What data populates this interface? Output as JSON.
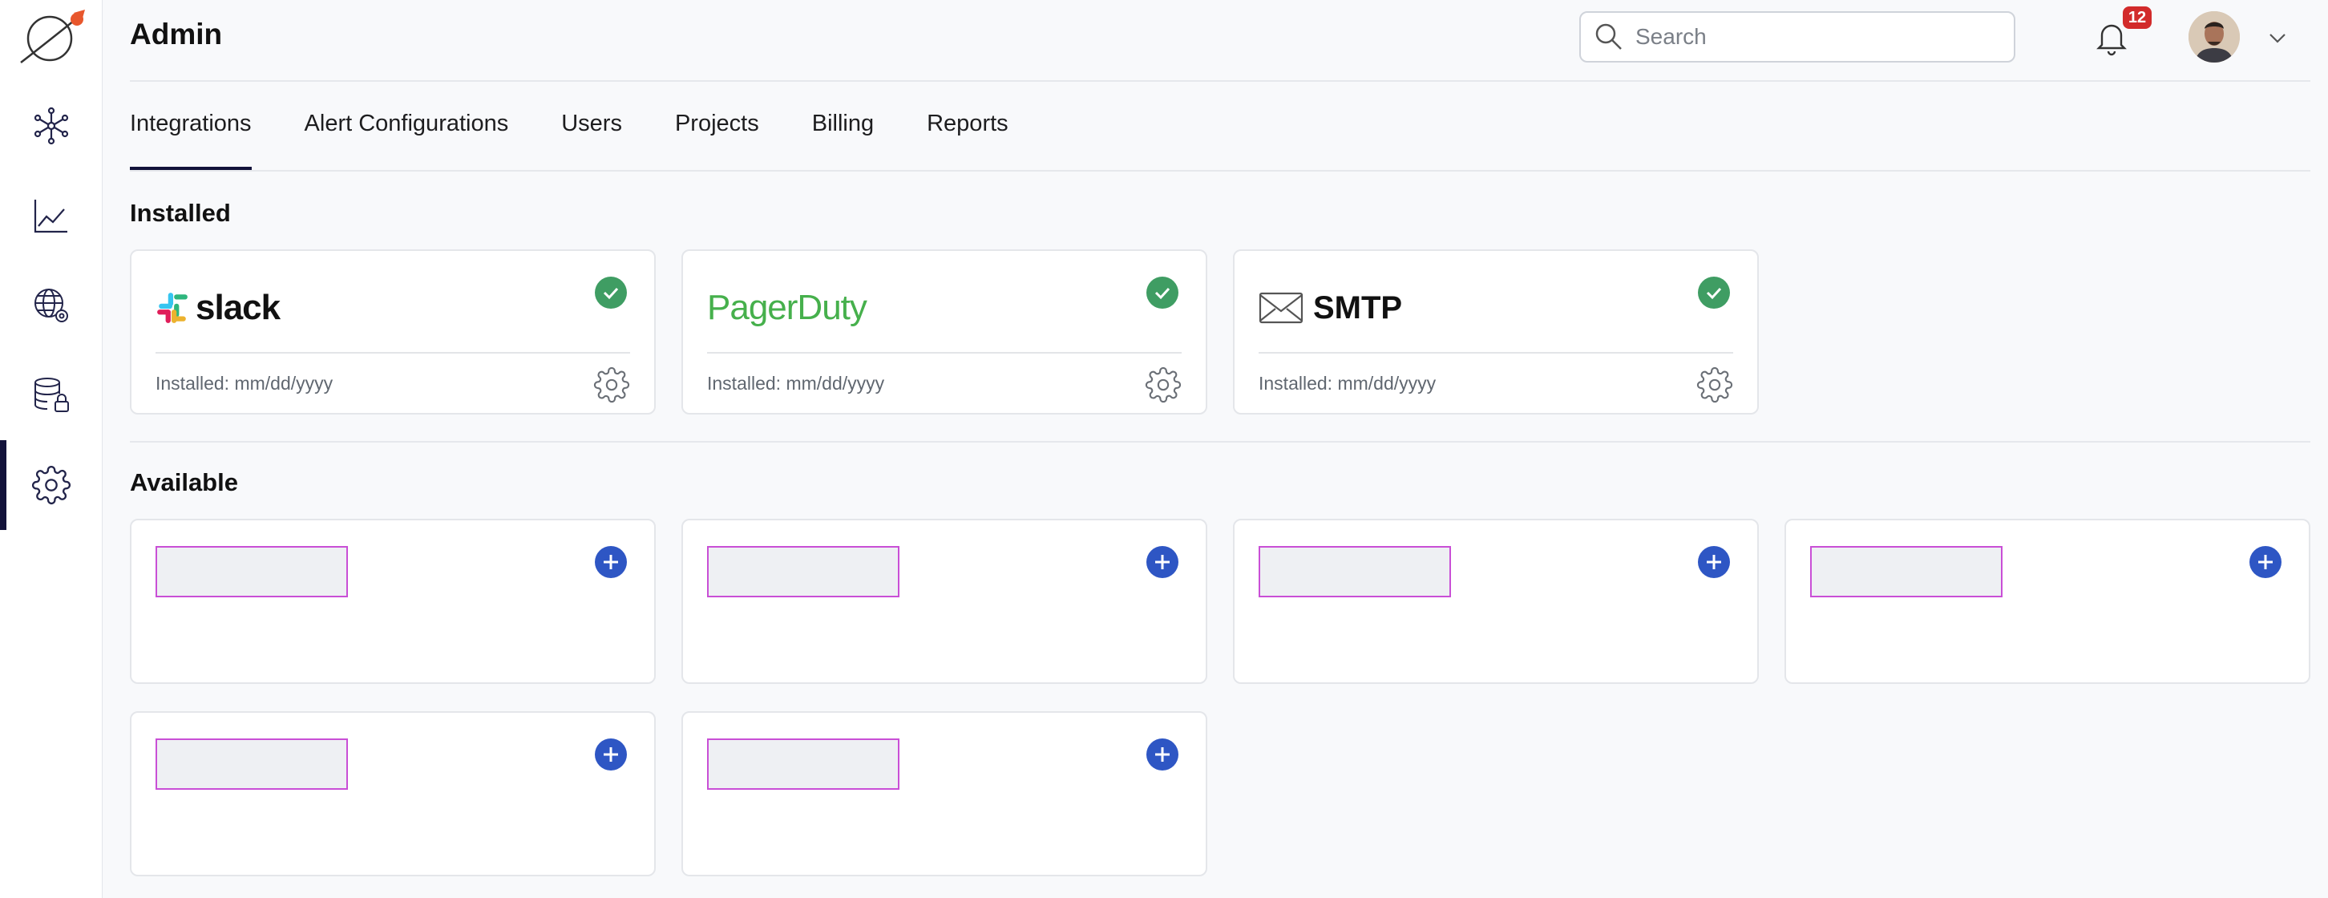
{
  "header": {
    "title": "Admin",
    "search_placeholder": "Search",
    "notification_count": "12"
  },
  "sidebar": {
    "items": [
      {
        "icon": "network-icon"
      },
      {
        "icon": "chart-line-icon"
      },
      {
        "icon": "globe-settings-icon"
      },
      {
        "icon": "database-lock-icon"
      },
      {
        "icon": "gear-icon",
        "active": true
      }
    ]
  },
  "tabs": [
    {
      "label": "Integrations",
      "active": true
    },
    {
      "label": "Alert Configurations"
    },
    {
      "label": "Users"
    },
    {
      "label": "Projects"
    },
    {
      "label": "Billing"
    },
    {
      "label": "Reports"
    }
  ],
  "sections": {
    "installed_title": "Installed",
    "available_title": "Available"
  },
  "installed": [
    {
      "name": "slack",
      "installed_text": "Installed: mm/dd/yyyy"
    },
    {
      "name": "PagerDuty",
      "installed_text": "Installed: mm/dd/yyyy"
    },
    {
      "name": "SMTP",
      "installed_text": "Installed: mm/dd/yyyy"
    }
  ],
  "colors": {
    "accent_dark": "#12123a",
    "check_green": "#3f9d63",
    "add_blue": "#2e56c4",
    "badge_red": "#d22b2b",
    "pagerduty_green": "#46b04c",
    "placeholder_border": "#c94fd6"
  }
}
